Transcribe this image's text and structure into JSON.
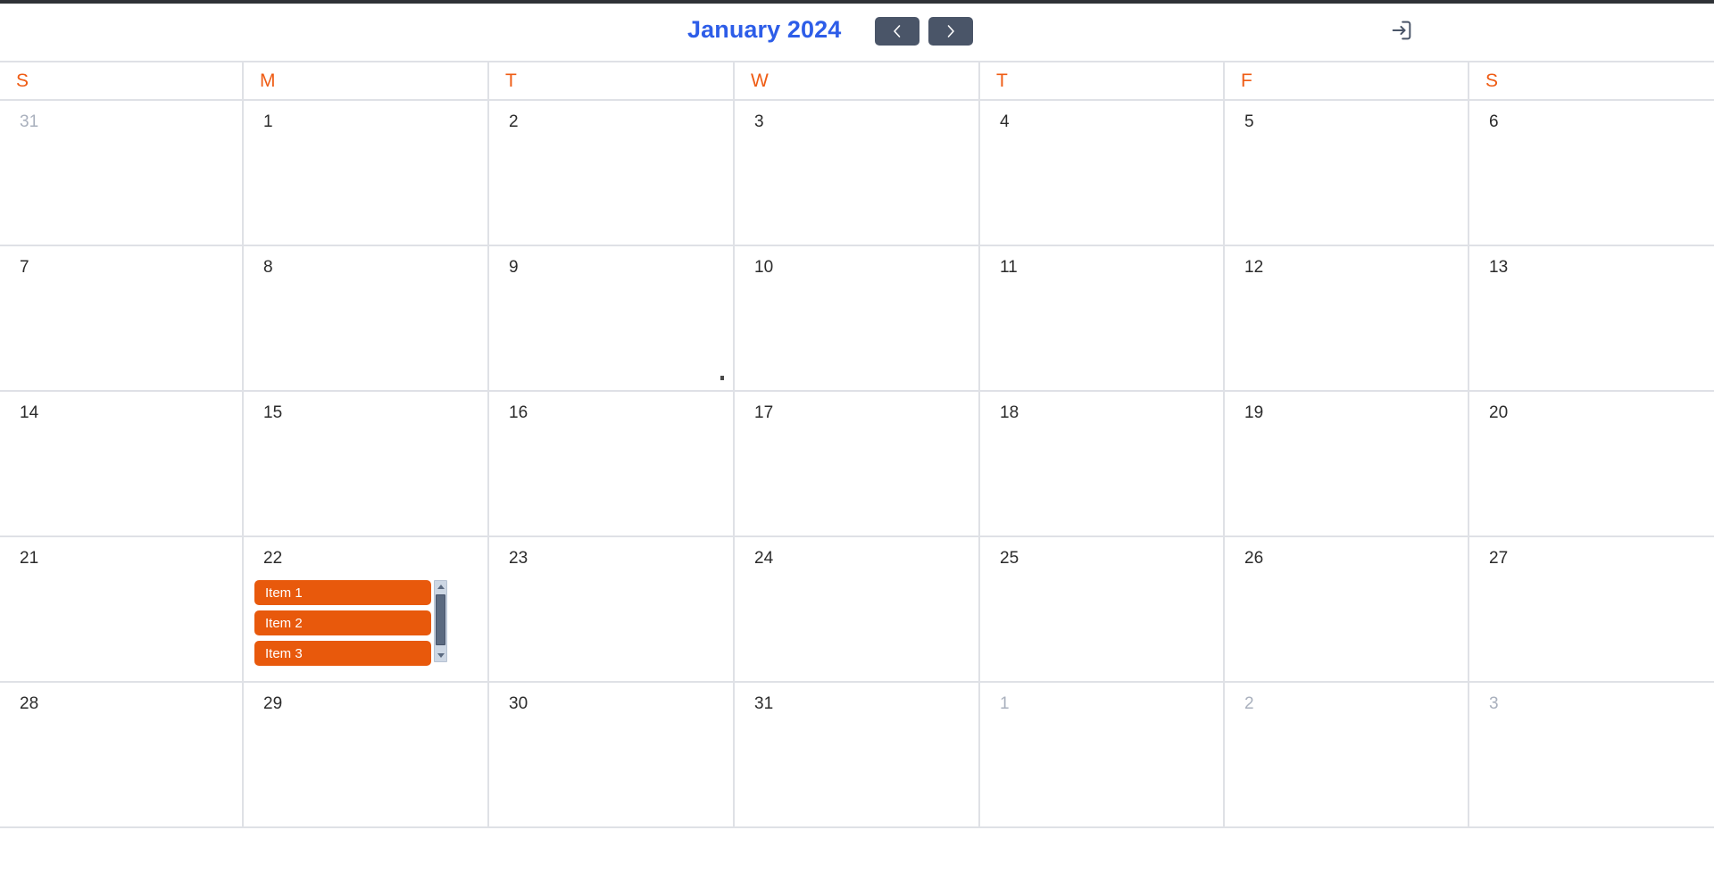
{
  "header": {
    "title": "January 2024",
    "prev_label": "‹",
    "next_label": "›",
    "prev_name": "previous-month",
    "next_name": "next-month",
    "login_name": "login-icon",
    "title_color": "#2d5de8",
    "nav_button_color": "#4a5568"
  },
  "weekdays": [
    {
      "label": "S"
    },
    {
      "label": "M"
    },
    {
      "label": "T"
    },
    {
      "label": "W"
    },
    {
      "label": "T"
    },
    {
      "label": "F"
    },
    {
      "label": "S"
    }
  ],
  "colors": {
    "accent_orange": "#ef5c14",
    "event_orange": "#e8590c",
    "grid_line": "#dfe1e6",
    "muted_day": "#a9b0bd",
    "day_text": "#2b2b2b"
  },
  "weeks": [
    [
      {
        "day": "31",
        "muted": true,
        "events": []
      },
      {
        "day": "1",
        "muted": false,
        "events": []
      },
      {
        "day": "2",
        "muted": false,
        "events": []
      },
      {
        "day": "3",
        "muted": false,
        "events": []
      },
      {
        "day": "4",
        "muted": false,
        "events": []
      },
      {
        "day": "5",
        "muted": false,
        "events": []
      },
      {
        "day": "6",
        "muted": false,
        "events": []
      }
    ],
    [
      {
        "day": "7",
        "muted": false,
        "events": []
      },
      {
        "day": "8",
        "muted": false,
        "events": []
      },
      {
        "day": "9",
        "muted": false,
        "events": []
      },
      {
        "day": "10",
        "muted": false,
        "events": []
      },
      {
        "day": "11",
        "muted": false,
        "events": []
      },
      {
        "day": "12",
        "muted": false,
        "events": []
      },
      {
        "day": "13",
        "muted": false,
        "events": []
      }
    ],
    [
      {
        "day": "14",
        "muted": false,
        "events": []
      },
      {
        "day": "15",
        "muted": false,
        "events": []
      },
      {
        "day": "16",
        "muted": false,
        "events": []
      },
      {
        "day": "17",
        "muted": false,
        "events": []
      },
      {
        "day": "18",
        "muted": false,
        "events": []
      },
      {
        "day": "19",
        "muted": false,
        "events": []
      },
      {
        "day": "20",
        "muted": false,
        "events": []
      }
    ],
    [
      {
        "day": "21",
        "muted": false,
        "events": []
      },
      {
        "day": "22",
        "muted": false,
        "scrollable": true,
        "events": [
          "Item 1",
          "Item 2",
          "Item 3"
        ]
      },
      {
        "day": "23",
        "muted": false,
        "events": []
      },
      {
        "day": "24",
        "muted": false,
        "events": []
      },
      {
        "day": "25",
        "muted": false,
        "events": []
      },
      {
        "day": "26",
        "muted": false,
        "events": []
      },
      {
        "day": "27",
        "muted": false,
        "events": []
      }
    ],
    [
      {
        "day": "28",
        "muted": false,
        "events": []
      },
      {
        "day": "29",
        "muted": false,
        "events": []
      },
      {
        "day": "30",
        "muted": false,
        "events": []
      },
      {
        "day": "31",
        "muted": false,
        "events": []
      },
      {
        "day": "1",
        "muted": true,
        "events": []
      },
      {
        "day": "2",
        "muted": true,
        "events": []
      },
      {
        "day": "3",
        "muted": true,
        "events": []
      }
    ]
  ]
}
